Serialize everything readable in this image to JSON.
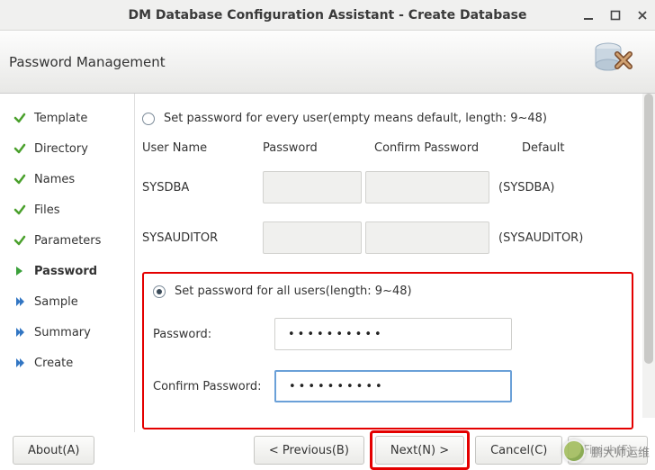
{
  "window": {
    "title": "DM Database Configuration Assistant - Create Database"
  },
  "header": {
    "title": "Password Management"
  },
  "sidebar": {
    "items": [
      {
        "label": "Template",
        "state": "done"
      },
      {
        "label": "Directory",
        "state": "done"
      },
      {
        "label": "Names",
        "state": "done"
      },
      {
        "label": "Files",
        "state": "done"
      },
      {
        "label": "Parameters",
        "state": "done"
      },
      {
        "label": "Password",
        "state": "current"
      },
      {
        "label": "Sample",
        "state": "pending"
      },
      {
        "label": "Summary",
        "state": "pending"
      },
      {
        "label": "Create",
        "state": "pending"
      }
    ]
  },
  "main": {
    "option_per_user": "Set password for every user(empty means default, length: 9~48)",
    "columns": {
      "user": "User Name",
      "password": "Password",
      "confirm": "Confirm Password",
      "default": "Default"
    },
    "users": [
      {
        "name": "SYSDBA",
        "default": "(SYSDBA)"
      },
      {
        "name": "SYSAUDITOR",
        "default": "(SYSAUDITOR)"
      }
    ],
    "option_all_users": "Set password for all users(length: 9~48)",
    "all_users_form": {
      "password_label": "Password:",
      "password_value": "••••••••••",
      "confirm_label": "Confirm Password:",
      "confirm_value": "••••••••••"
    }
  },
  "footer": {
    "about": "About(A)",
    "previous": "< Previous(B)",
    "next": "Next(N) >",
    "cancel": "Cancel(C)",
    "finish": "Finish(F)"
  },
  "watermark": {
    "text": "鹏大师运维"
  }
}
